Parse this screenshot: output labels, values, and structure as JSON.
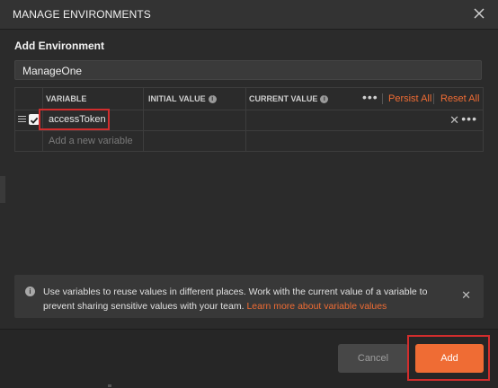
{
  "window": {
    "title": "MANAGE ENVIRONMENTS"
  },
  "form": {
    "section_label": "Add Environment",
    "environment_name": "ManageOne"
  },
  "table": {
    "headers": {
      "variable": "VARIABLE",
      "initial_value": "INITIAL VALUE",
      "current_value": "CURRENT VALUE"
    },
    "actions": {
      "more": "•••",
      "persist_all": "Persist All",
      "reset_all": "Reset All"
    },
    "rows": [
      {
        "checked": true,
        "variable": "accessToken",
        "initial_value": "",
        "current_value": ""
      }
    ],
    "new_row_placeholder": "Add a new variable"
  },
  "info": {
    "text": "Use variables to reuse values in different places. Work with the current value of a variable to prevent sharing sensitive values with your team.",
    "link": "Learn more about variable values"
  },
  "footer": {
    "cancel_label": "Cancel",
    "add_label": "Add"
  },
  "colors": {
    "accent": "#ef6c34",
    "highlight": "#d12d2d",
    "background": "#2b2b2b"
  },
  "icons": [
    "close-icon",
    "info-icon",
    "drag-handle-icon",
    "checkbox-checked-icon",
    "more-icon"
  ]
}
